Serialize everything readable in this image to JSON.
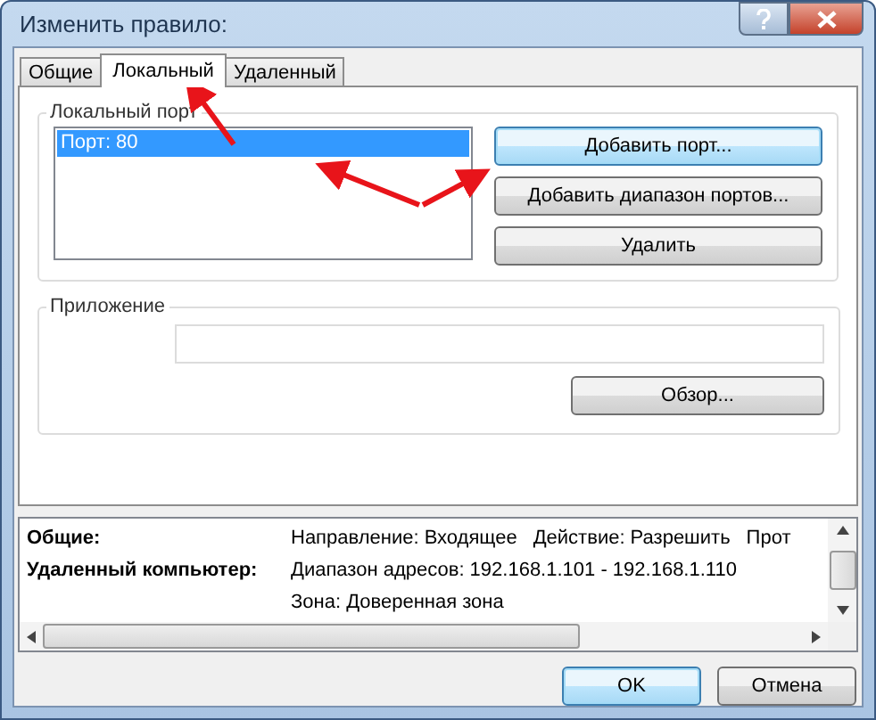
{
  "window": {
    "title": "Изменить правило:"
  },
  "tabs": [
    {
      "label": "Общие",
      "selected": false
    },
    {
      "label": "Локальный",
      "selected": true
    },
    {
      "label": "Удаленный",
      "selected": false
    }
  ],
  "local_port": {
    "title": "Локальный порт",
    "items": [
      {
        "label": "Порт: 80",
        "selected": true
      }
    ],
    "buttons": [
      {
        "label": "Добавить порт...",
        "focused": true
      },
      {
        "label": "Добавить диапазон портов...",
        "focused": false
      },
      {
        "label": "Удалить",
        "focused": false
      }
    ]
  },
  "application": {
    "title": "Приложение",
    "browse_button": "Обзор..."
  },
  "summary": {
    "rows": [
      {
        "label": "Общие:",
        "values": [
          "Направление: Входящее",
          "Действие: Разрешить",
          "Прот"
        ]
      },
      {
        "label": "Удаленный компьютер:",
        "values": [
          "Диапазон адресов: 192.168.1.101 - 192.168.1.110"
        ]
      },
      {
        "values": [
          "Зона: Доверенная зона"
        ]
      }
    ]
  },
  "buttons": [
    {
      "label": "OK",
      "focused": true
    },
    {
      "label": "Отмена",
      "focused": false
    }
  ]
}
